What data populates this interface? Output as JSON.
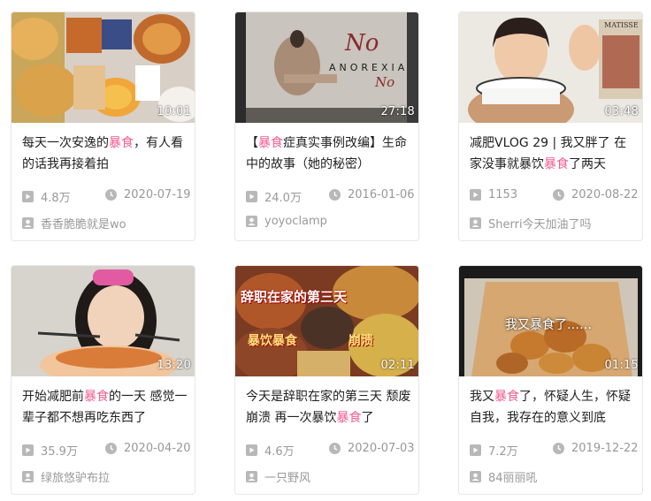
{
  "cards": [
    {
      "duration": "10:01",
      "title_parts": [
        "每天一次安逸的",
        "暴食",
        "，有人看的话我再接着拍"
      ],
      "views": "4.8万",
      "date": "2020-07-19",
      "uploader": "香香脆脆就是wo"
    },
    {
      "duration": "27:18",
      "title_parts": [
        "【",
        "暴食",
        "症真实事例改编】生命中的故事（她的秘密）"
      ],
      "views": "24.0万",
      "date": "2016-01-06",
      "uploader": "yoyoclamp",
      "thumb_text": [
        "No",
        "ANOREXIA",
        "No"
      ]
    },
    {
      "duration": "03:48",
      "title_parts": [
        "减肥VLOG 29 | 我又胖了 在家没事就暴饮",
        "暴食",
        "了两天"
      ],
      "views": "1153",
      "date": "2020-08-22",
      "uploader": "Sherri今天加油了吗",
      "thumb_text": [
        "MATISSE"
      ]
    },
    {
      "duration": "13:20",
      "title_parts": [
        "开始减肥前",
        "暴食",
        "的一天 感觉一辈子都不想再吃东西了"
      ],
      "views": "35.9万",
      "date": "2020-04-20",
      "uploader": "绿旅悠驴布拉"
    },
    {
      "duration": "02:11",
      "title_parts": [
        "今天是辞职在家的第三天 颓废 崩溃 再一次暴饮",
        "暴食",
        "了"
      ],
      "views": "4.6万",
      "date": "2020-07-03",
      "uploader": "一只野风",
      "thumb_text": [
        "辞职在家的第三天",
        "暴饮暴食",
        "崩溃"
      ]
    },
    {
      "duration": "01:15",
      "title_parts": [
        "我又",
        "暴食",
        "了，怀疑人生，怀疑自我，我存在的意义到底"
      ],
      "views": "7.2万",
      "date": "2019-12-22",
      "uploader": "84丽丽吼",
      "thumb_text": [
        "我又暴食了……"
      ]
    }
  ],
  "colors": {
    "highlight": "#f25d8e",
    "meta": "#999999",
    "title": "#212121"
  },
  "icons": {
    "views": "play-square-icon",
    "date": "clock-icon",
    "uploader": "user-icon"
  }
}
